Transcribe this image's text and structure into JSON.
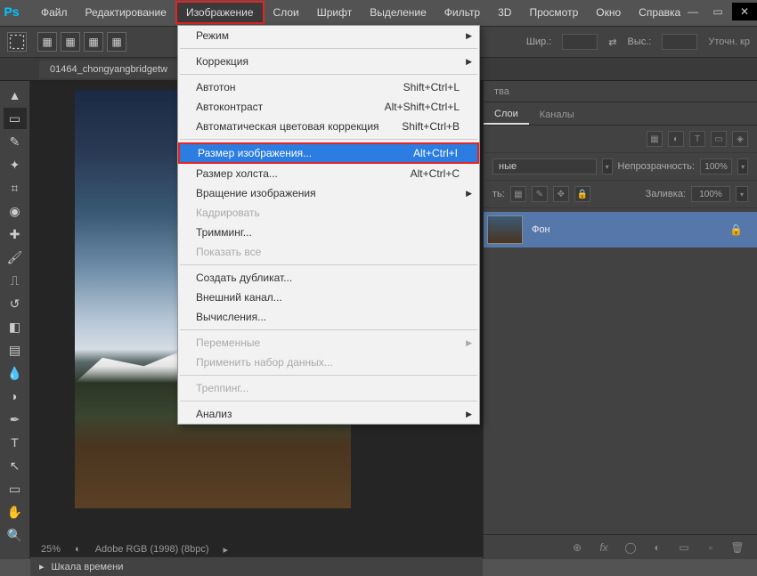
{
  "app": {
    "logo": "Ps"
  },
  "menus": [
    "Файл",
    "Редактирование",
    "Изображение",
    "Слои",
    "Шрифт",
    "Выделение",
    "Фильтр",
    "3D",
    "Просмотр",
    "Окно",
    "Справка"
  ],
  "active_menu_index": 2,
  "dropdown": {
    "groups": [
      [
        {
          "label": "Режим",
          "arrow": true
        }
      ],
      [
        {
          "label": "Коррекция",
          "arrow": true
        }
      ],
      [
        {
          "label": "Автотон",
          "shortcut": "Shift+Ctrl+L"
        },
        {
          "label": "Автоконтраст",
          "shortcut": "Alt+Shift+Ctrl+L"
        },
        {
          "label": "Автоматическая цветовая коррекция",
          "shortcut": "Shift+Ctrl+B"
        }
      ],
      [
        {
          "label": "Размер изображения...",
          "shortcut": "Alt+Ctrl+I",
          "highlight": true
        },
        {
          "label": "Размер холста...",
          "shortcut": "Alt+Ctrl+C"
        },
        {
          "label": "Вращение изображения",
          "arrow": true
        },
        {
          "label": "Кадрировать",
          "disabled": true
        },
        {
          "label": "Тримминг..."
        },
        {
          "label": "Показать все",
          "disabled": true
        }
      ],
      [
        {
          "label": "Создать дубликат..."
        },
        {
          "label": "Внешний канал..."
        },
        {
          "label": "Вычисления..."
        }
      ],
      [
        {
          "label": "Переменные",
          "arrow": true,
          "disabled": true
        },
        {
          "label": "Применить набор данных...",
          "disabled": true
        }
      ],
      [
        {
          "label": "Треппинг...",
          "disabled": true
        }
      ],
      [
        {
          "label": "Анализ",
          "arrow": true
        }
      ]
    ]
  },
  "options": {
    "width_label": "Шир.:",
    "height_label": "Выс.:",
    "right_text": "Уточн. кр"
  },
  "doc_tab": "01464_chongyangbridgetw",
  "canvas": {
    "zoom": "25%",
    "profile": "Adobe RGB (1998) (8bpc)"
  },
  "panels": {
    "properties_tab": "тва",
    "layers_tab": "Слои",
    "channels_tab": "Каналы",
    "blend_mode": "ные",
    "opacity_label": "Непрозрачность:",
    "opacity_val": "100%",
    "lock_label": "ть:",
    "fill_label": "Заливка:",
    "fill_val": "100%",
    "layer_name": "Фон"
  },
  "timeline": {
    "label": "Шкала времени"
  }
}
